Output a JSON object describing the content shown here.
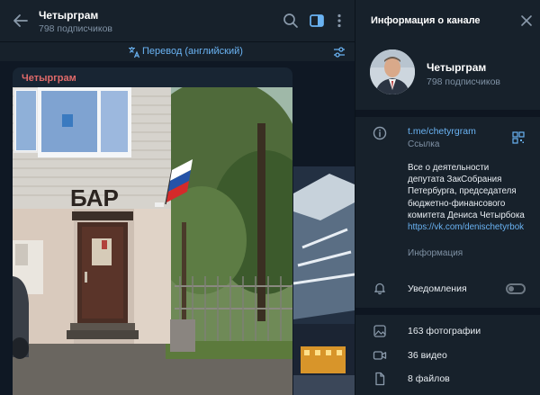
{
  "chat": {
    "title": "Четыргрaм",
    "subtitle": "798 подписчиков",
    "translate_label": "Перевод (английский)"
  },
  "message": {
    "author": "Четыргрaм",
    "sign_text": "БАР"
  },
  "info_panel": {
    "title": "Информация о канале",
    "channel_name": "Четыргрaм",
    "subscribers": "798 подписчиков",
    "link": "t.me/chetyrgram",
    "link_caption": "Ссылка",
    "description": "Все о деятельности депутата ЗакСобрания Петербурга, председателя бюджетно-финансового комитета Дениса Четырбока",
    "description_link": "https://vk.com/denischetyrbok",
    "description_caption": "Информация",
    "notifications_label": "Уведомления",
    "notifications_on": false,
    "photos": "163 фотографии",
    "videos": "36 видео",
    "files": "8 файлов"
  },
  "colors": {
    "accent": "#6ab3f3",
    "author": "#e06a6a",
    "panel_bg": "#17212b",
    "chat_bg": "#0e1621"
  },
  "icons": [
    "back-arrow-icon",
    "search-icon",
    "sidebar-toggle-icon",
    "more-vertical-icon",
    "translate-icon",
    "sliders-icon",
    "close-icon",
    "info-icon",
    "qr-code-icon",
    "bell-icon",
    "photo-icon",
    "video-icon",
    "file-icon"
  ]
}
